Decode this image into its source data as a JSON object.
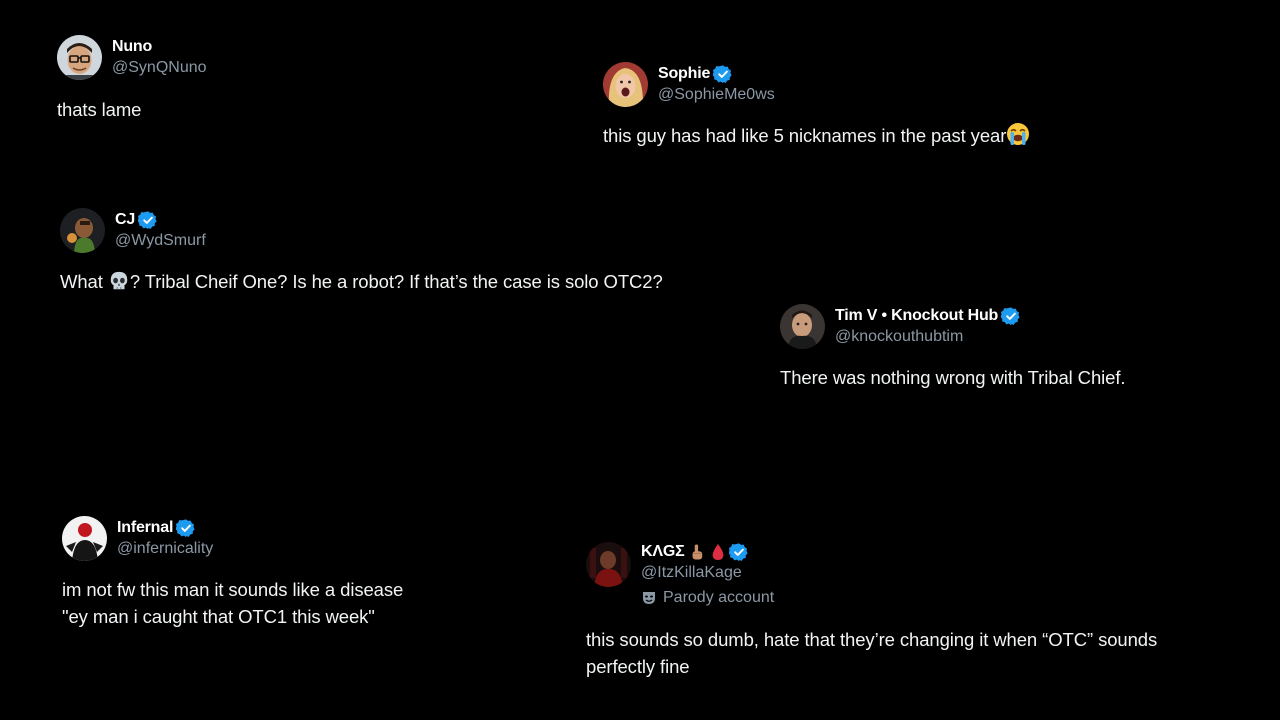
{
  "tweets": [
    {
      "name": "Nuno",
      "handle": "@SynQNuno",
      "verified": false,
      "avatar_icon": "avatar-glasses-man",
      "text": [
        "thats lame"
      ]
    },
    {
      "name": "Sophie",
      "handle": "@SophieMe0ws",
      "verified": true,
      "avatar_icon": "avatar-blonde-woman",
      "text": [
        "this guy has had like 5 nicknames in the past year"
      ],
      "text_emoji": "loudly-crying-face"
    },
    {
      "name": "CJ",
      "handle": "@WydSmurf",
      "verified": true,
      "avatar_icon": "avatar-cartoon",
      "text_before_emoji": "What ",
      "text_emoji": "skull",
      "text_after_emoji": "? Tribal Cheif One? Is he a robot? If that’s the case is solo OTC2?"
    },
    {
      "name": "Tim V • Knockout Hub",
      "handle": "@knockouthubtim",
      "verified": true,
      "avatar_icon": "avatar-photo",
      "text": [
        "There was nothing wrong with Tribal Chief."
      ]
    },
    {
      "name": "Infernal",
      "handle": "@infernicality",
      "verified": true,
      "avatar_icon": "avatar-red-white",
      "text": [
        "im not fw this man it sounds like a disease",
        "\"ey man i caught that OTC1 this week\""
      ]
    },
    {
      "name": "ΚΛGΣ",
      "name_emojis": [
        "pointing-up-hand",
        "drop-of-blood"
      ],
      "handle": "@ItzKillaKage",
      "verified": true,
      "avatar_icon": "avatar-dark-red",
      "parody_label": "Parody account",
      "parody_icon": "theater-mask-icon",
      "text": [
        "this sounds so dumb, hate that they’re changing it when “OTC” sounds",
        "perfectly fine"
      ]
    }
  ],
  "colors": {
    "background": "#000000",
    "name": "#ffffff",
    "handle": "#8b98a5",
    "text": "#f1f3f4",
    "verified": "#1d9bf0"
  }
}
